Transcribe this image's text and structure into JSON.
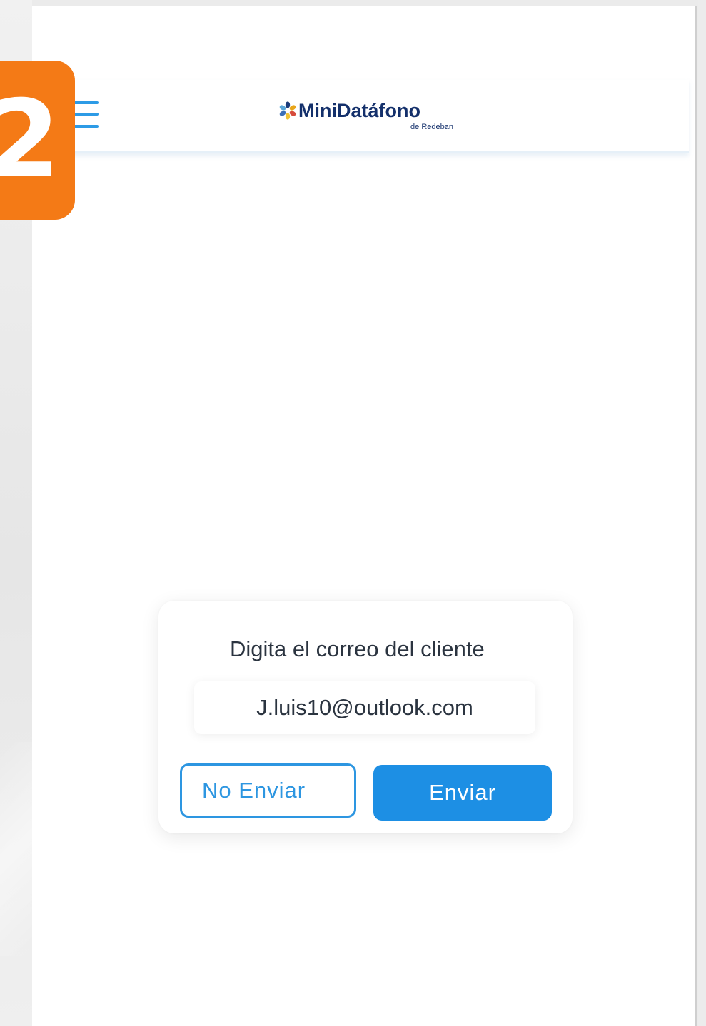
{
  "step": {
    "number": "2",
    "color": "#f47a16"
  },
  "header": {
    "menu_icon": "hamburger-menu-icon",
    "logo": {
      "name": "MiniDatáfono",
      "subtitle": "de Redeban",
      "text_color": "#14306b"
    }
  },
  "dialog": {
    "title": "Digita el correo del cliente",
    "email_value": "J.luis10@outlook.com",
    "buttons": {
      "secondary_label": "No Enviar",
      "primary_label": "Enviar"
    },
    "accent_color": "#1d8fe4"
  }
}
